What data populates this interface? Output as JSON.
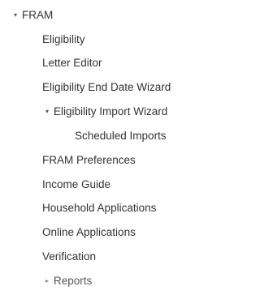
{
  "tree": {
    "root": {
      "expanded_icon": "▾",
      "label": "FRAM"
    },
    "items": [
      {
        "label": "Eligibility"
      },
      {
        "label": "Letter Editor"
      },
      {
        "label": "Eligibility End Date Wizard"
      },
      {
        "label": "Eligibility Import Wizard",
        "icon": "▾"
      },
      {
        "label": "Scheduled Imports"
      },
      {
        "label": "FRAM Preferences"
      },
      {
        "label": "Income Guide"
      },
      {
        "label": "Household Applications"
      },
      {
        "label": "Online Applications"
      },
      {
        "label": "Verification"
      },
      {
        "label": "Reports",
        "icon": "▸"
      }
    ]
  }
}
